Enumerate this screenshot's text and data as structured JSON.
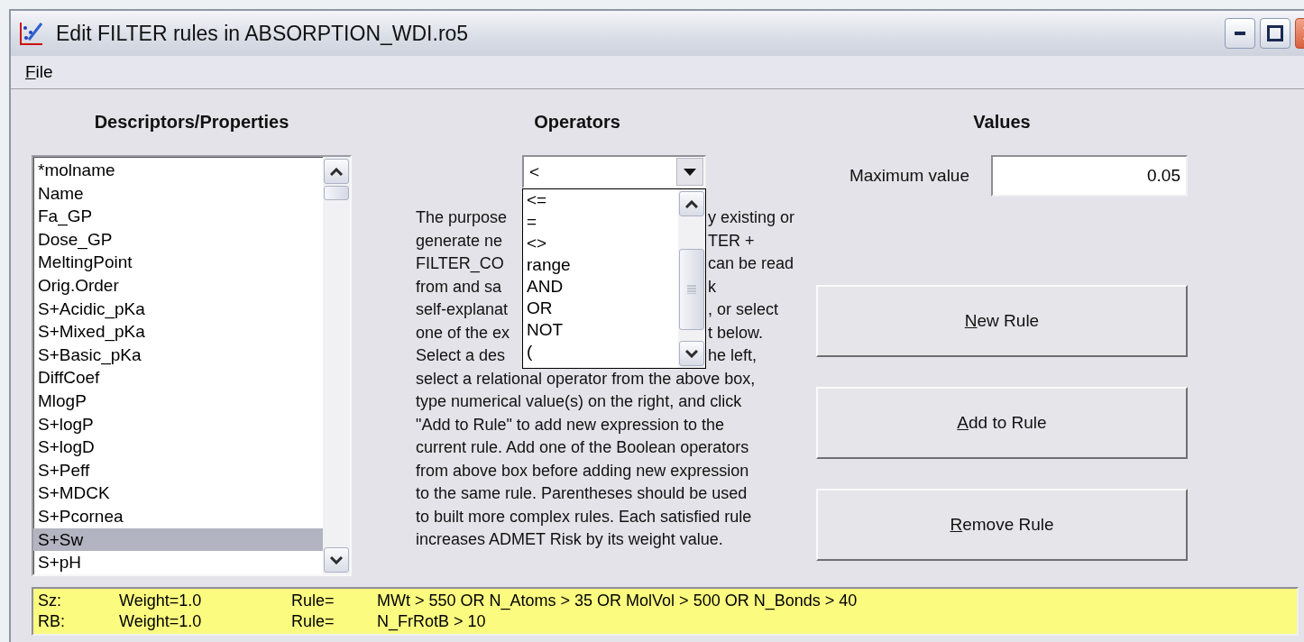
{
  "window": {
    "title": "Edit FILTER rules in ABSORPTION_WDI.ro5"
  },
  "menu": [
    {
      "label": "File",
      "underline_first": true
    }
  ],
  "descriptors": {
    "header": "Descriptors/Properties",
    "items": [
      {
        "label": "*molname",
        "selected": false
      },
      {
        "label": "Name",
        "selected": false
      },
      {
        "label": "Fa_GP",
        "selected": false
      },
      {
        "label": "Dose_GP",
        "selected": false
      },
      {
        "label": "MeltingPoint",
        "selected": false
      },
      {
        "label": "Orig.Order",
        "selected": false
      },
      {
        "label": "S+Acidic_pKa",
        "selected": false
      },
      {
        "label": "S+Mixed_pKa",
        "selected": false
      },
      {
        "label": "S+Basic_pKa",
        "selected": false
      },
      {
        "label": "DiffCoef",
        "selected": false
      },
      {
        "label": "MlogP",
        "selected": false
      },
      {
        "label": "S+logP",
        "selected": false
      },
      {
        "label": "S+logD",
        "selected": false
      },
      {
        "label": "S+Peff",
        "selected": false
      },
      {
        "label": "S+MDCK",
        "selected": false
      },
      {
        "label": "S+Pcornea",
        "selected": false
      },
      {
        "label": "S+Sw",
        "selected": true
      },
      {
        "label": "S+pH",
        "selected": false
      }
    ]
  },
  "operators": {
    "header": "Operators",
    "value": "<",
    "options": [
      {
        "label": "<=",
        "selected": false
      },
      {
        "label": "=",
        "selected": false
      },
      {
        "label": "<>",
        "selected": false
      },
      {
        "label": "range",
        "selected": false
      },
      {
        "label": "AND",
        "selected": false
      },
      {
        "label": "OR",
        "selected": false
      },
      {
        "label": "NOT",
        "selected": false
      },
      {
        "label": "(",
        "selected": false
      }
    ],
    "description": [
      {
        "left": "The purpose",
        "right": "y existing or"
      },
      {
        "left": "generate ne",
        "right": "TER +"
      },
      {
        "left": "FILTER_CO",
        "right": "can be read"
      },
      {
        "left": "from and sa",
        "right": "k"
      },
      {
        "left": "self-explanat",
        "right": ", or select"
      },
      {
        "left": "one of the ex",
        "right": "t below."
      },
      {
        "left": "Select a des",
        "right": "he left,"
      },
      {
        "text": "select a relational operator from the above box,"
      },
      {
        "text": "type numerical value(s) on the right, and click"
      },
      {
        "text": "\"Add to Rule\" to add new expression to the"
      },
      {
        "text": "current rule. Add one of the Boolean operators"
      },
      {
        "text": "from above box before adding new expression"
      },
      {
        "text": "to the same rule. Parentheses should be used"
      },
      {
        "text": "to built more complex rules. Each satisfied rule"
      },
      {
        "text": "increases ADMET Risk by its weight value."
      }
    ]
  },
  "values": {
    "header": "Values",
    "label": "Maximum value",
    "value": "0.05"
  },
  "buttons": [
    {
      "label": "New Rule",
      "underline_first": true
    },
    {
      "label": "Add to Rule",
      "underline_first": true
    },
    {
      "label": "Remove Rule",
      "underline_first": true
    }
  ],
  "rules": [
    {
      "name": "Sz:",
      "weight": "Weight=1.0",
      "rule_label": "Rule=",
      "expression": "MWt > 550 OR N_Atoms > 35 OR MolVol > 500 OR N_Bonds > 40"
    },
    {
      "name": "RB:",
      "weight": "Weight=1.0",
      "rule_label": "Rule=",
      "expression": "N_FrRotB > 10"
    }
  ]
}
